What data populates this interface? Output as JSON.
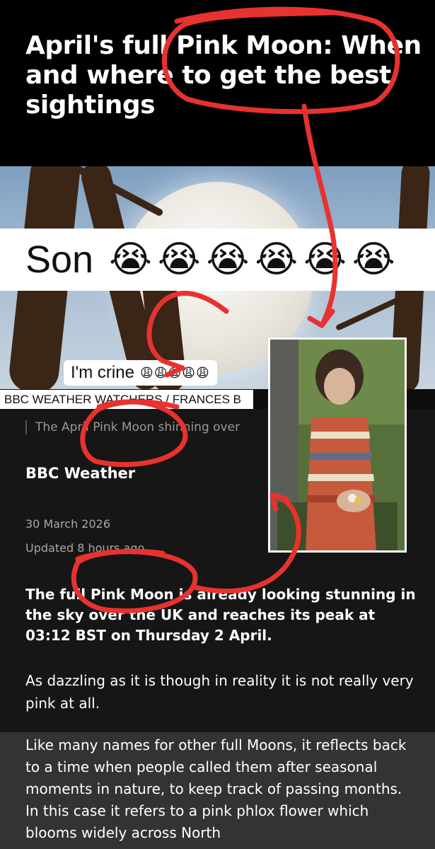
{
  "article": {
    "headline": "April's full Pink Moon: When and where to get the best sightings",
    "image_credit": "BBC WEATHER WATCHERS / FRANCES B",
    "caption": "The April Pink Moon shinning over",
    "author": "BBC Weather",
    "date": "30 March 2026",
    "updated": "Updated 8 hours ago",
    "lead": "The full Pink Moon is already looking stunning in the sky over the UK and reaches its peak at 03:12 BST on Thursday 2 April.",
    "para1": "As dazzling as it is though in reality it is not really very pink at all.",
    "para2": "Like many names for other full Moons, it reflects back to a time when people called them after seasonal moments in nature, to keep track of passing months. In this case it refers to a pink phlox flower which blooms widely across North"
  },
  "overlay": {
    "son_text": "Son",
    "son_emojis": "😭😭😭😭😭😭",
    "crine_text": "I'm crine",
    "crine_emojis": "😩😩😩😩😩",
    "annotation_color": "#e8322f"
  }
}
